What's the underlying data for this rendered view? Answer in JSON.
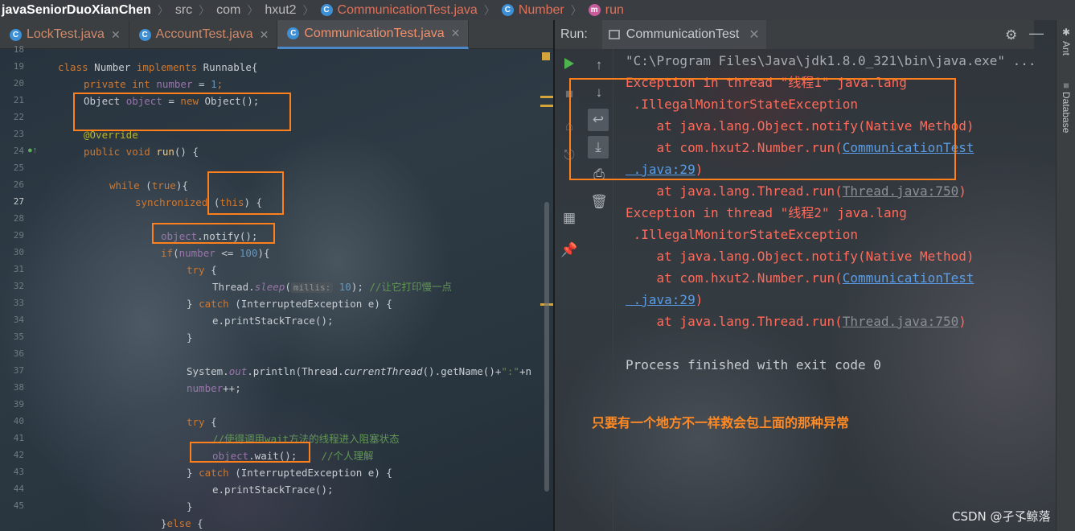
{
  "breadcrumb": {
    "project": "javaSeniorDuoXianChen",
    "items": [
      "src",
      "com",
      "hxut2"
    ],
    "file": "CommunicationTest.java",
    "cls": "Number",
    "method": "run"
  },
  "editor": {
    "tabs": [
      {
        "label": "LockTest.java",
        "active": false
      },
      {
        "label": "AccountTest.java",
        "active": false
      },
      {
        "label": "CommunicationTest.java",
        "active": true
      }
    ],
    "line_numbers": [
      "18",
      "19",
      "20",
      "21",
      "22",
      "23",
      "24",
      "25",
      "26",
      "27",
      "28",
      "29",
      "30",
      "31",
      "32",
      "33",
      "34",
      "35",
      "36",
      "37",
      "38",
      "39",
      "40",
      "41",
      "42",
      "43",
      "44",
      "45"
    ],
    "code": {
      "l19_a": "class",
      "l19_b": " Number ",
      "l19_c": "implements",
      "l19_d": " Runnable{",
      "l20_a": "private",
      "l20_b": " int ",
      "l20_c": "number",
      "l20_d": " = ",
      "l20_e": "1",
      "l20_f": ";",
      "l21_a": "Object ",
      "l21_b": "object",
      "l21_c": " = ",
      "l21_d": "new",
      "l21_e": " Object();",
      "l23": "@Override",
      "l24_a": "public",
      "l24_b": " void ",
      "l24_c": "run",
      "l24_d": "() {",
      "l26_a": "while",
      "l26_b": " (",
      "l26_c": "true",
      "l26_d": "){",
      "l27_a": "synchronized",
      "l27_b": " (",
      "l27_c": "this",
      "l27_d": ") {",
      "l29_a": "object",
      "l29_b": ".notify();",
      "l30_a": "if",
      "l30_b": "(",
      "l30_c": "number",
      "l30_d": " <= ",
      "l30_e": "100",
      "l30_f": "){",
      "l31_a": "try",
      "l31_b": " {",
      "l32_a": "Thread.",
      "l32_b": "sleep",
      "l32_c": "(",
      "l32_hint": "millis:",
      "l32_d": " ",
      "l32_e": "10",
      "l32_f": "); ",
      "l32_g": "//让它打印慢一点",
      "l33_a": "} ",
      "l33_b": "catch",
      "l33_c": " (InterruptedException e) {",
      "l34": "e.printStackTrace();",
      "l35": "}",
      "l37_a": "System.",
      "l37_b": "out",
      "l37_c": ".println(Thread.",
      "l37_d": "currentThread",
      "l37_e": "().getName()+",
      "l37_f": "\":\"",
      "l37_g": "+n",
      "l38_a": "number",
      "l38_b": "++;",
      "l40_a": "try",
      "l40_b": " {",
      "l41": "//使得调用wait方法的线程进入阻塞状态",
      "l42_a": "object",
      "l42_b": ".wait();",
      "l42_c": "    //个人理解",
      "l43_a": "} ",
      "l43_b": "catch",
      "l43_c": " (InterruptedException e) {",
      "l44": "e.printStackTrace();",
      "l45": "}",
      "l46_a": "}",
      "l46_b": "else",
      "l46_c": " {"
    }
  },
  "run": {
    "label": "Run:",
    "tab": "CommunicationTest",
    "console": {
      "cmd": "\"C:\\Program Files\\Java\\jdk1.8.0_321\\bin\\java.exe\" ...",
      "e1_l1": "Exception in thread \"线程1\" java.lang",
      "e1_l2": " .IllegalMonitorStateException",
      "e1_l3": "    at java.lang.Object.notify(Native Method)",
      "e1_l4_a": "    at com.hxut2.Number.run(",
      "e1_l4_b": "CommunicationTest",
      "e1_l5_a": " .java:29",
      "e1_l5_b": ")",
      "e1_l6_a": "    at java.lang.Thread.run(",
      "e1_l6_b": "Thread.java:750",
      "e1_l6_c": ")",
      "e2_l1": "Exception in thread \"线程2\" java.lang",
      "e2_l2": " .IllegalMonitorStateException",
      "e2_l3": "    at java.lang.Object.notify(Native Method)",
      "e2_l4_a": "    at com.hxut2.Number.run(",
      "e2_l4_b": "CommunicationTest",
      "e2_l5_a": " .java:29",
      "e2_l5_b": ")",
      "e2_l6_a": "    at java.lang.Thread.run(",
      "e2_l6_b": "Thread.java:750",
      "e2_l6_c": ")",
      "exit": "Process finished with exit code 0"
    },
    "note": "只要有一个地方不一样救会包上面的那种异常"
  },
  "side": {
    "ant": "Ant",
    "database": "Database"
  },
  "watermark": "CSDN @孑孓鲸落",
  "colors": {
    "highlight_box": "#ff7f1a",
    "error": "#ff6b5b",
    "link": "#5a9de6",
    "note": "#ff8a24"
  }
}
